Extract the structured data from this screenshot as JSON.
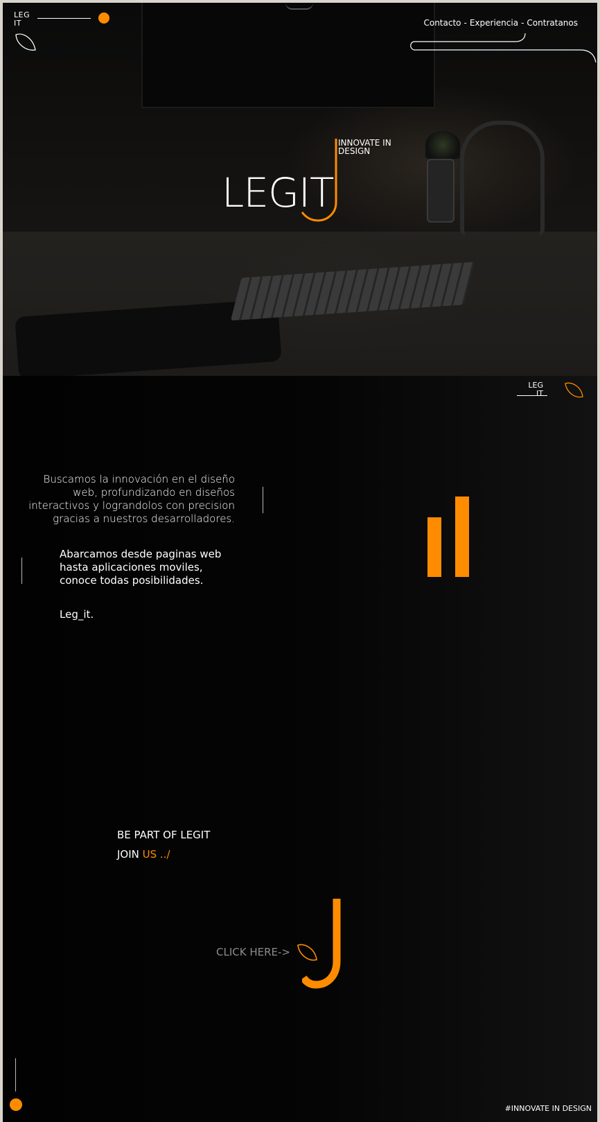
{
  "colors": {
    "accent": "#ff8c00",
    "background": "#050505",
    "text": "#ffffff",
    "muted": "#8c8c8c"
  },
  "header": {
    "logo_line1": "LEG",
    "logo_line2": "IT",
    "nav": [
      "Contacto",
      "Experiencia",
      "Contratanos"
    ],
    "nav_separator": "-"
  },
  "hero": {
    "brand": "LEGIT",
    "tagline_line1": "INNOVATE IN",
    "tagline_line2": "DESIGN"
  },
  "about": {
    "logo_line1": "LEG",
    "logo_line2": "IT",
    "paragraph1": "Buscamos la innovación en el diseño web, profundizando en diseños interactivos y lograndolos con precision gracias a nuestros desarrolladores.",
    "paragraph2": "Abarcamos desde paginas web hasta aplicaciones moviles, conoce todas posibilidades.",
    "signature": "Leg_it."
  },
  "cta": {
    "line1": "BE PART OF LEGIT",
    "line2_prefix": "JOIN",
    "line2_accent": "US ../",
    "click": "CLICK HERE->"
  },
  "footer": {
    "tag": "#INNOVATE IN DESIGN"
  },
  "icons": [
    "leaf-icon",
    "orange-dot-icon",
    "j-hook-icon",
    "bar-chart-icon"
  ]
}
